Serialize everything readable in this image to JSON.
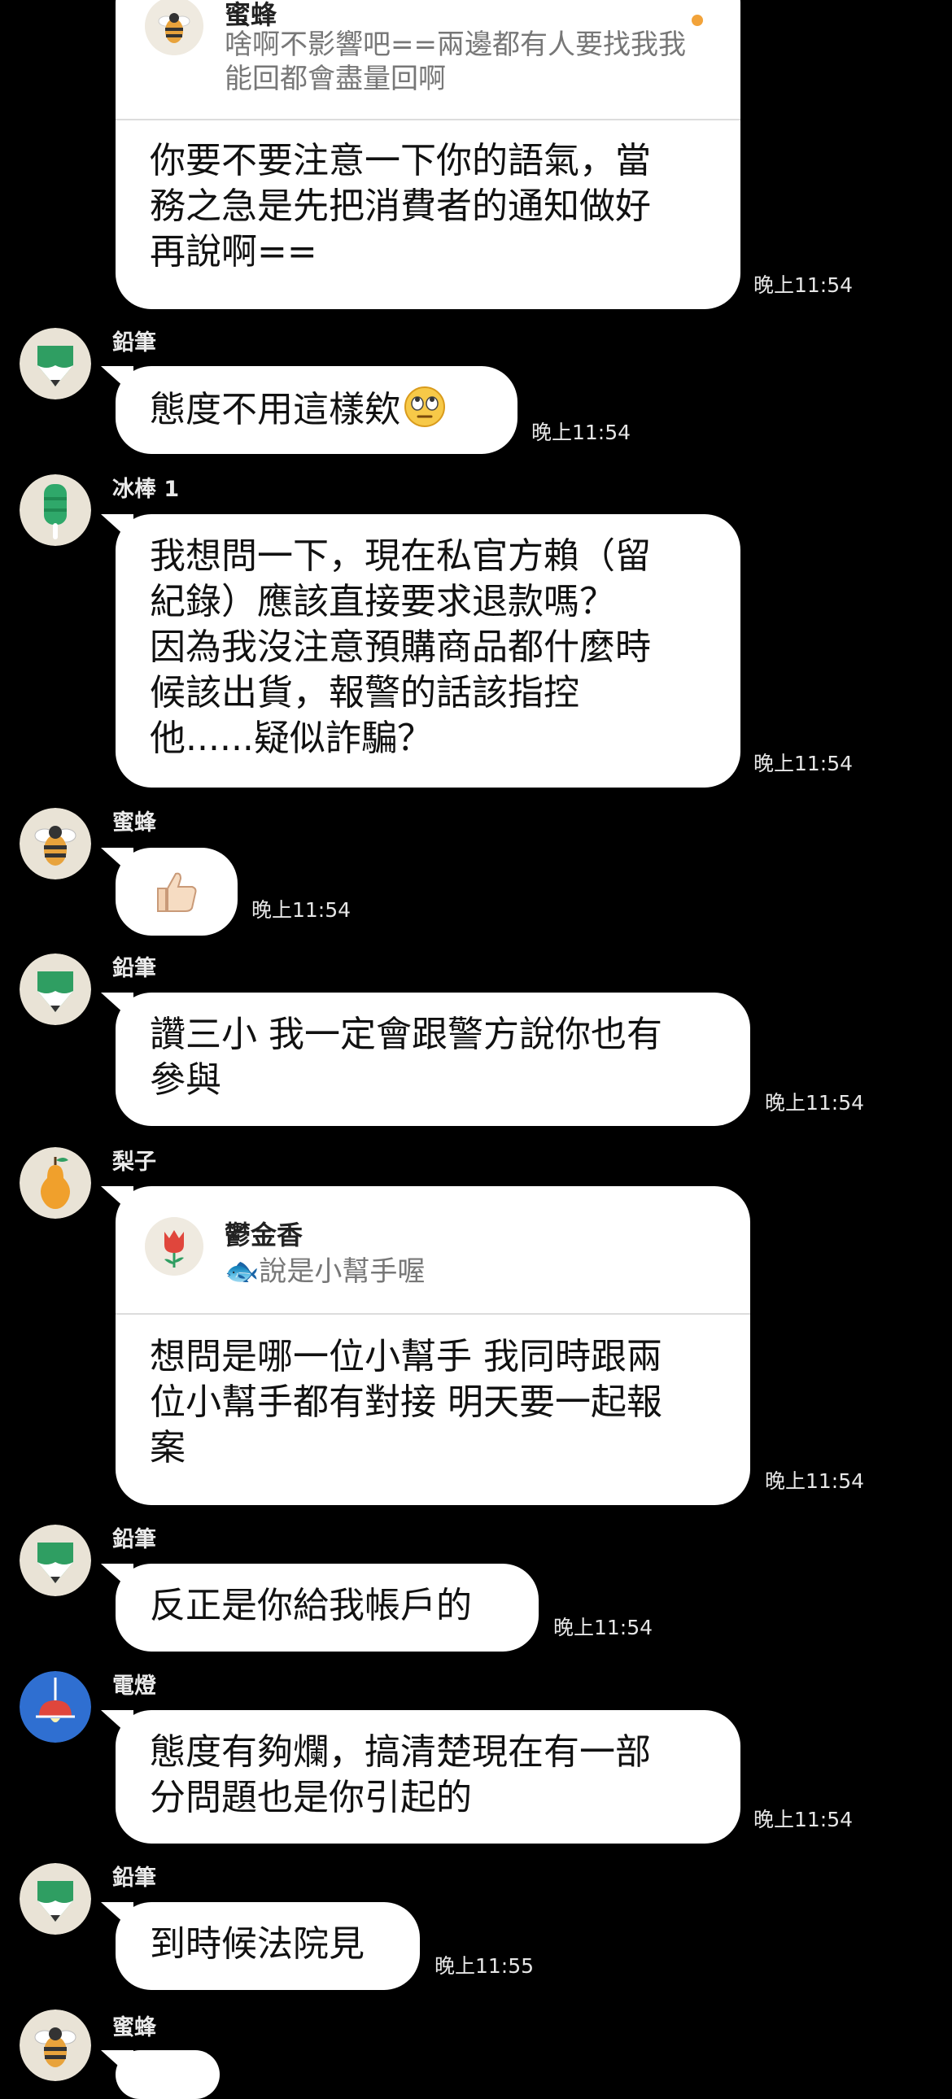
{
  "messages": {
    "m0": {
      "reply_name": "蜜蜂",
      "reply_line1": "啥啊不影響吧==兩邊都有人要找我我",
      "reply_line2": "能回都會盡量回啊",
      "line1": "你要不要注意一下你的語氣，當",
      "line2": "務之急是先把消費者的通知做好",
      "line3": "再說啊==",
      "time": "晚上11:54"
    },
    "m1": {
      "sender": "鉛筆",
      "line1": "態度不用這樣欸",
      "emoji": "rolling-eyes-face",
      "time": "晚上11:54"
    },
    "m2": {
      "sender": "冰棒 1",
      "line1": "我想問一下，現在私官方賴（留",
      "line2": "紀錄）應該直接要求退款嗎？",
      "line3": "因為我沒注意預購商品都什麼時",
      "line4": "候該出貨，報警的話該指控",
      "line5": "他......疑似詐騙？",
      "time": "晚上11:54"
    },
    "m3": {
      "sender": "蜜蜂",
      "emoji": "thumbs-up",
      "time": "晚上11:54"
    },
    "m4": {
      "sender": "鉛筆",
      "line1": "讚三小 我一定會跟警方說你也有",
      "line2": "參與",
      "time": "晚上11:54"
    },
    "m5": {
      "sender": "梨子",
      "reply_name": "鬱金香",
      "reply_line1": "🐟說是小幫手喔",
      "line1": "想問是哪一位小幫手 我同時跟兩",
      "line2": "位小幫手都有對接 明天要一起報",
      "line3": "案",
      "time": "晚上11:54"
    },
    "m6": {
      "sender": "鉛筆",
      "line1": "反正是你給我帳戶的",
      "time": "晚上11:54"
    },
    "m7": {
      "sender": "電燈",
      "line1": "態度有夠爛，搞清楚現在有一部",
      "line2": "分問題也是你引起的",
      "time": "晚上11:54"
    },
    "m8": {
      "sender": "鉛筆",
      "line1": "到時候法院見",
      "time": "晚上11:55"
    },
    "m9": {
      "sender": "蜜蜂"
    }
  },
  "colors": {
    "background": "#000000",
    "bubble": "#ffffff",
    "unread_dot": "#f2a33a"
  }
}
